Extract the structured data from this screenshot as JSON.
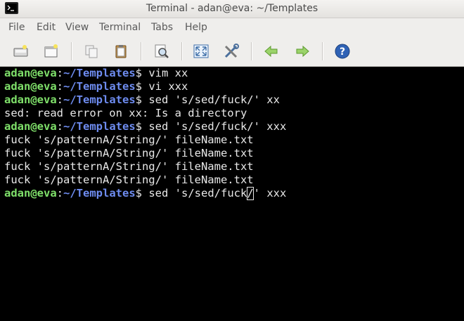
{
  "window": {
    "title": "Terminal - adan@eva: ~/Templates"
  },
  "menu": [
    "File",
    "Edit",
    "View",
    "Terminal",
    "Tabs",
    "Help"
  ],
  "toolbar": {
    "icons": [
      "new-tab-icon",
      "new-window-icon",
      "copy-icon",
      "paste-icon",
      "find-icon",
      "fullscreen-icon",
      "preferences-icon",
      "back-arrow-icon",
      "forward-arrow-icon",
      "help-icon"
    ]
  },
  "colors": {
    "user": "#7fe06a",
    "path": "#6e8cf0",
    "text": "#e8e8e8",
    "background": "#000000"
  },
  "terminal": {
    "prompt": {
      "user": "adan@eva",
      "colon": ":",
      "path": "~/Templates",
      "symbol": "$"
    },
    "lines": [
      {
        "cmd": " vim xx"
      },
      {
        "cmd": " vi xxx"
      },
      {
        "cmd": " sed 's/sed/fuck/' xx"
      },
      {
        "output": "sed: read error on xx: Is a directory"
      },
      {
        "cmd": " sed 's/sed/fuck/' xxx"
      },
      {
        "output": "fuck 's/patternA/String/' fileName.txt"
      },
      {
        "output": "fuck 's/patternA/String/' fileName.txt"
      },
      {
        "output": "fuck 's/patternA/String/' fileName.txt"
      },
      {
        "output": "fuck 's/patternA/String/' fileName.txt"
      },
      {
        "cmd_before_cursor": " sed 's/sed/fuck",
        "cursor_char": "/",
        "cmd_after_cursor": "' xxx"
      }
    ]
  }
}
